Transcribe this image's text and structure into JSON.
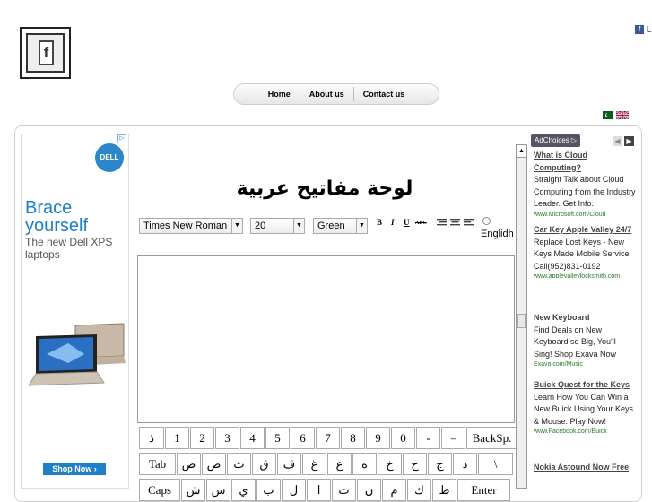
{
  "page": {
    "title_arabic": "لوحة مفاتيح عربية",
    "fb_logo_letter": "f",
    "fb_top_text": "L"
  },
  "nav": {
    "items": [
      "Home",
      "About us",
      "Contact us"
    ]
  },
  "toolbar": {
    "font_family": "Times New Roman",
    "font_size": "20",
    "color": "Green",
    "bold": "B",
    "italic": "I",
    "underline": "U",
    "strike": "ABC",
    "english_label": "Englidh"
  },
  "dell_ad": {
    "brand": "DELL",
    "headline": "Brace yourself",
    "subline": "The new Dell XPS laptops",
    "button": "Shop Now ›",
    "corner_icon": "adchoices-triangle-icon"
  },
  "keyboard": {
    "row1": [
      "ذ",
      "1",
      "2",
      "3",
      "4",
      "5",
      "6",
      "7",
      "8",
      "9",
      "0",
      "-",
      "=",
      "BackSp."
    ],
    "row2": [
      "Tab",
      "ض",
      "ص",
      "ث",
      "ق",
      "ف",
      "غ",
      "ع",
      "ه",
      "خ",
      "ح",
      "ج",
      "د",
      "\\"
    ],
    "row3": [
      "Caps",
      "ش",
      "س",
      "ي",
      "ب",
      "ل",
      "ا",
      "ت",
      "ن",
      "م",
      "ك",
      "ط",
      "Enter"
    ]
  },
  "ads": {
    "header": "AdChoices ▷",
    "items": [
      {
        "title": "What is Cloud Computing?",
        "body": "Straight Talk about Cloud Computing from the Industry Leader. Get Info.",
        "url": "www.Microsoft.com/Cloud"
      },
      {
        "title": "Car Key Apple Valley 24/7",
        "body": "Replace Lost Keys - New Keys Made Mobile Service Call(952)831-0192",
        "url": "www.applevalleylocksmith.com"
      },
      {
        "title": "New Keyboard",
        "body": "Find Deals on New Keyboard so Big, You'll Sing! Shop Exava Now",
        "url": "Exava.com/Music"
      },
      {
        "title": "Buick Quest for the Keys",
        "body": "Learn How You Can Win a New Buick Using Your Keys & Mouse. Play Now!",
        "url": "www.Facebook.com/Buick"
      },
      {
        "title": "Nokia Astound Now Free",
        "body": "",
        "url": ""
      }
    ]
  }
}
